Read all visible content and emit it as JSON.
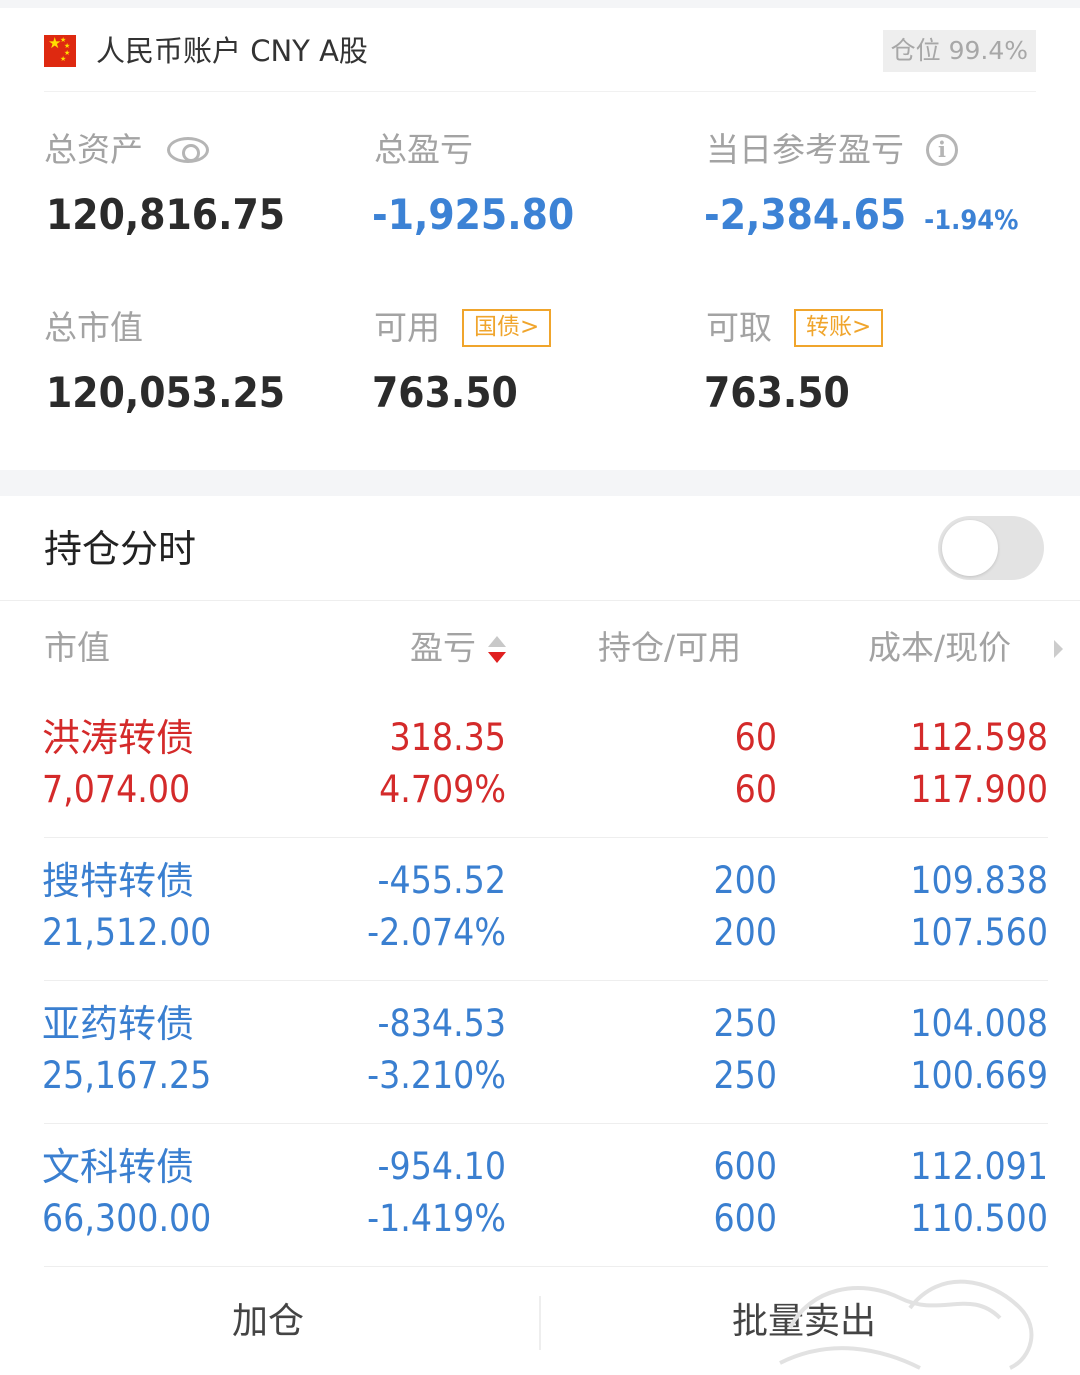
{
  "header": {
    "account_title": "人民币账户 CNY A股",
    "position_badge": "仓位 99.4%"
  },
  "summary": {
    "total_assets_label": "总资产",
    "total_assets_value": "120,816.75",
    "total_pl_label": "总盈亏",
    "total_pl_value": "-1,925.80",
    "daily_pl_label": "当日参考盈亏",
    "daily_pl_value": "-2,384.65",
    "daily_pl_pct": "-1.94%",
    "market_value_label": "总市值",
    "market_value_value": "120,053.25",
    "available_label": "可用",
    "available_tag": "国债>",
    "available_value": "763.50",
    "withdrawable_label": "可取",
    "withdrawable_tag": "转账>",
    "withdrawable_value": "763.50"
  },
  "holdings": {
    "title": "持仓分时",
    "toggle_on": false,
    "columns": {
      "market_value": "市值",
      "pl": "盈亏",
      "qty": "持仓/可用",
      "cost": "成本/现价"
    },
    "rows": [
      {
        "name": "洪涛转债",
        "market_value": "7,074.00",
        "pl": "318.35",
        "pl_pct": "4.709%",
        "qty": "60",
        "available": "60",
        "cost": "112.598",
        "price": "117.900",
        "trend": "up"
      },
      {
        "name": "搜特转债",
        "market_value": "21,512.00",
        "pl": "-455.52",
        "pl_pct": "-2.074%",
        "qty": "200",
        "available": "200",
        "cost": "109.838",
        "price": "107.560",
        "trend": "down"
      },
      {
        "name": "亚药转债",
        "market_value": "25,167.25",
        "pl": "-834.53",
        "pl_pct": "-3.210%",
        "qty": "250",
        "available": "250",
        "cost": "104.008",
        "price": "100.669",
        "trend": "down"
      },
      {
        "name": "文科转债",
        "market_value": "66,300.00",
        "pl": "-954.10",
        "pl_pct": "-1.419%",
        "qty": "600",
        "available": "600",
        "cost": "112.091",
        "price": "110.500",
        "trend": "down"
      }
    ]
  },
  "footer": {
    "add_label": "加仓",
    "batch_sell_label": "批量卖出"
  },
  "colors": {
    "up": "#d42a2a",
    "down": "#3a7fd0",
    "accent_tag": "#f0a52c",
    "muted": "#a3a3a3"
  },
  "icons": [
    "cn-flag-icon",
    "eye-icon",
    "info-icon",
    "sort-icon",
    "chevron-right-icon"
  ]
}
